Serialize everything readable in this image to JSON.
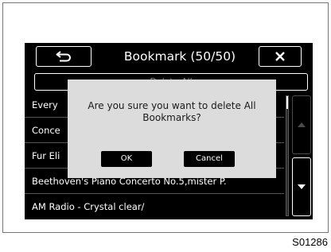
{
  "header": {
    "back_icon": "return-arrow-icon",
    "title": "Bookmark (50/50)",
    "close_icon": "close-x-icon"
  },
  "delete_all_label": "Delete All",
  "bookmarks": [
    {
      "label": "Every"
    },
    {
      "label": "Conce"
    },
    {
      "label": "Fur Eli"
    },
    {
      "label": "Beethoven's Piano Concerto No.5,mister P."
    },
    {
      "label": "AM Radio - Crystal clear/"
    }
  ],
  "scroll": {
    "up_icon": "triangle-up-icon",
    "down_icon": "triangle-down-icon"
  },
  "dialog": {
    "message": "Are you sure you want to delete All Bookmarks?",
    "ok_label": "OK",
    "cancel_label": "Cancel"
  },
  "figure_code": "S01286",
  "colors": {
    "screen_bg": "#000000",
    "dialog_bg": "#dcdcdc",
    "text": "#ffffff",
    "disabled_text": "#8a8a8a"
  }
}
